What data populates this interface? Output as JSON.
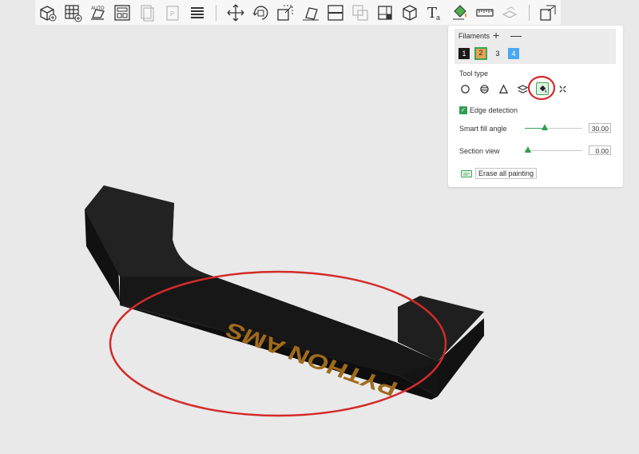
{
  "toolbar": {
    "buttons": [
      "add-cube-icon",
      "grid-add-icon",
      "auto-orient-icon",
      "arrange-icon",
      "copy-icon",
      "paste-icon",
      "layers-list-icon",
      "move-icon",
      "rotate-icon",
      "scale-icon",
      "lay-on-face-icon",
      "cut-icon",
      "boolean-icon",
      "seam-icon",
      "cube-tool-icon",
      "text-tool-icon",
      "paint-bucket-icon",
      "measure-icon",
      "assembly-icon",
      "view-icon"
    ]
  },
  "panel": {
    "filaments_label": "Filaments",
    "plus": "+",
    "minus": "—",
    "filaments": [
      {
        "label": "1",
        "color": "#1a1a1a"
      },
      {
        "label": "2",
        "color": "#e8a255"
      },
      {
        "label": "3",
        "color": "#ececec"
      },
      {
        "label": "4",
        "color": "#4aa8f2"
      }
    ],
    "tool_type_label": "Tool type",
    "tools": [
      "circle-tool-icon",
      "sphere-tool-icon",
      "triangle-tool-icon",
      "height-range-icon",
      "fill-tool-icon",
      "gap-fill-icon"
    ],
    "edge_detection_label": "Edge detection",
    "smart_fill_label": "Smart fill angle",
    "smart_fill_value": "30.00",
    "smart_fill_level": 0.35,
    "section_view_label": "Section view",
    "section_view_value": "0.00",
    "section_view_level": 0.05,
    "erase_label": "Erase all painting"
  },
  "model": {
    "text": "PYTHON AMS",
    "body_color": "#1c1c1c",
    "text_color": "#a06a1c",
    "annotation_color": "#d42a2a"
  }
}
